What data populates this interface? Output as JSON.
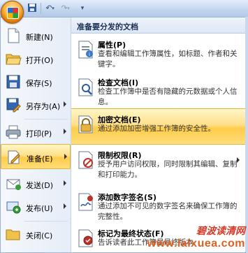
{
  "qat": {
    "save_icon": "save-icon",
    "undo_icon": "undo-icon",
    "redo_icon": "redo-icon",
    "customize_icon": "customize-qat-icon"
  },
  "menu": {
    "left_items": [
      {
        "label": "新建(N)",
        "icon": "new-document-icon",
        "has_arrow": false
      },
      {
        "label": "打开(O)",
        "icon": "open-folder-icon",
        "has_arrow": false
      },
      {
        "label": "保存(S)",
        "icon": "save-disk-icon",
        "has_arrow": false
      },
      {
        "label": "另存为(A)",
        "icon": "save-as-icon",
        "has_arrow": true
      },
      {
        "label": "打印(P)",
        "icon": "printer-icon",
        "has_arrow": true
      },
      {
        "label": "准备(E)",
        "icon": "prepare-icon",
        "has_arrow": true
      },
      {
        "label": "发送(D)",
        "icon": "send-icon",
        "has_arrow": true
      },
      {
        "label": "发布(U)",
        "icon": "publish-icon",
        "has_arrow": true
      },
      {
        "label": "关闭(C)",
        "icon": "close-folder-icon",
        "has_arrow": false
      }
    ],
    "panel": {
      "header": "准备要分发的文档",
      "items": [
        {
          "title": "属性(P)",
          "desc": "查看和编辑工作簿属性，如标题、作者和关键字。",
          "icon": "properties-icon"
        },
        {
          "title": "检查文档(I)",
          "desc": "检查工作簿中是否有隐藏的元数据或个人信息。",
          "icon": "inspect-document-icon"
        },
        {
          "title": "加密文档(E)",
          "desc": "通过添加加密增强工作簿的安全性。",
          "icon": "encrypt-lock-icon"
        },
        {
          "title": "限制权限(R)",
          "desc": "授予用户访问权限，同时限制其编辑、复制和打印能力。",
          "icon": "restrict-permission-icon"
        },
        {
          "title": "添加数字签名(S)",
          "desc": "通过添加不可见的数字签名来确保工作簿的完整性。",
          "icon": "digital-signature-icon"
        },
        {
          "title": "标记为最终状态(F)",
          "desc": "告诉读者此工作簿是最终版本",
          "icon": "mark-final-icon"
        }
      ]
    }
  },
  "watermark": {
    "cn": "碧波读清网",
    "url": "www.laixuea.com"
  }
}
